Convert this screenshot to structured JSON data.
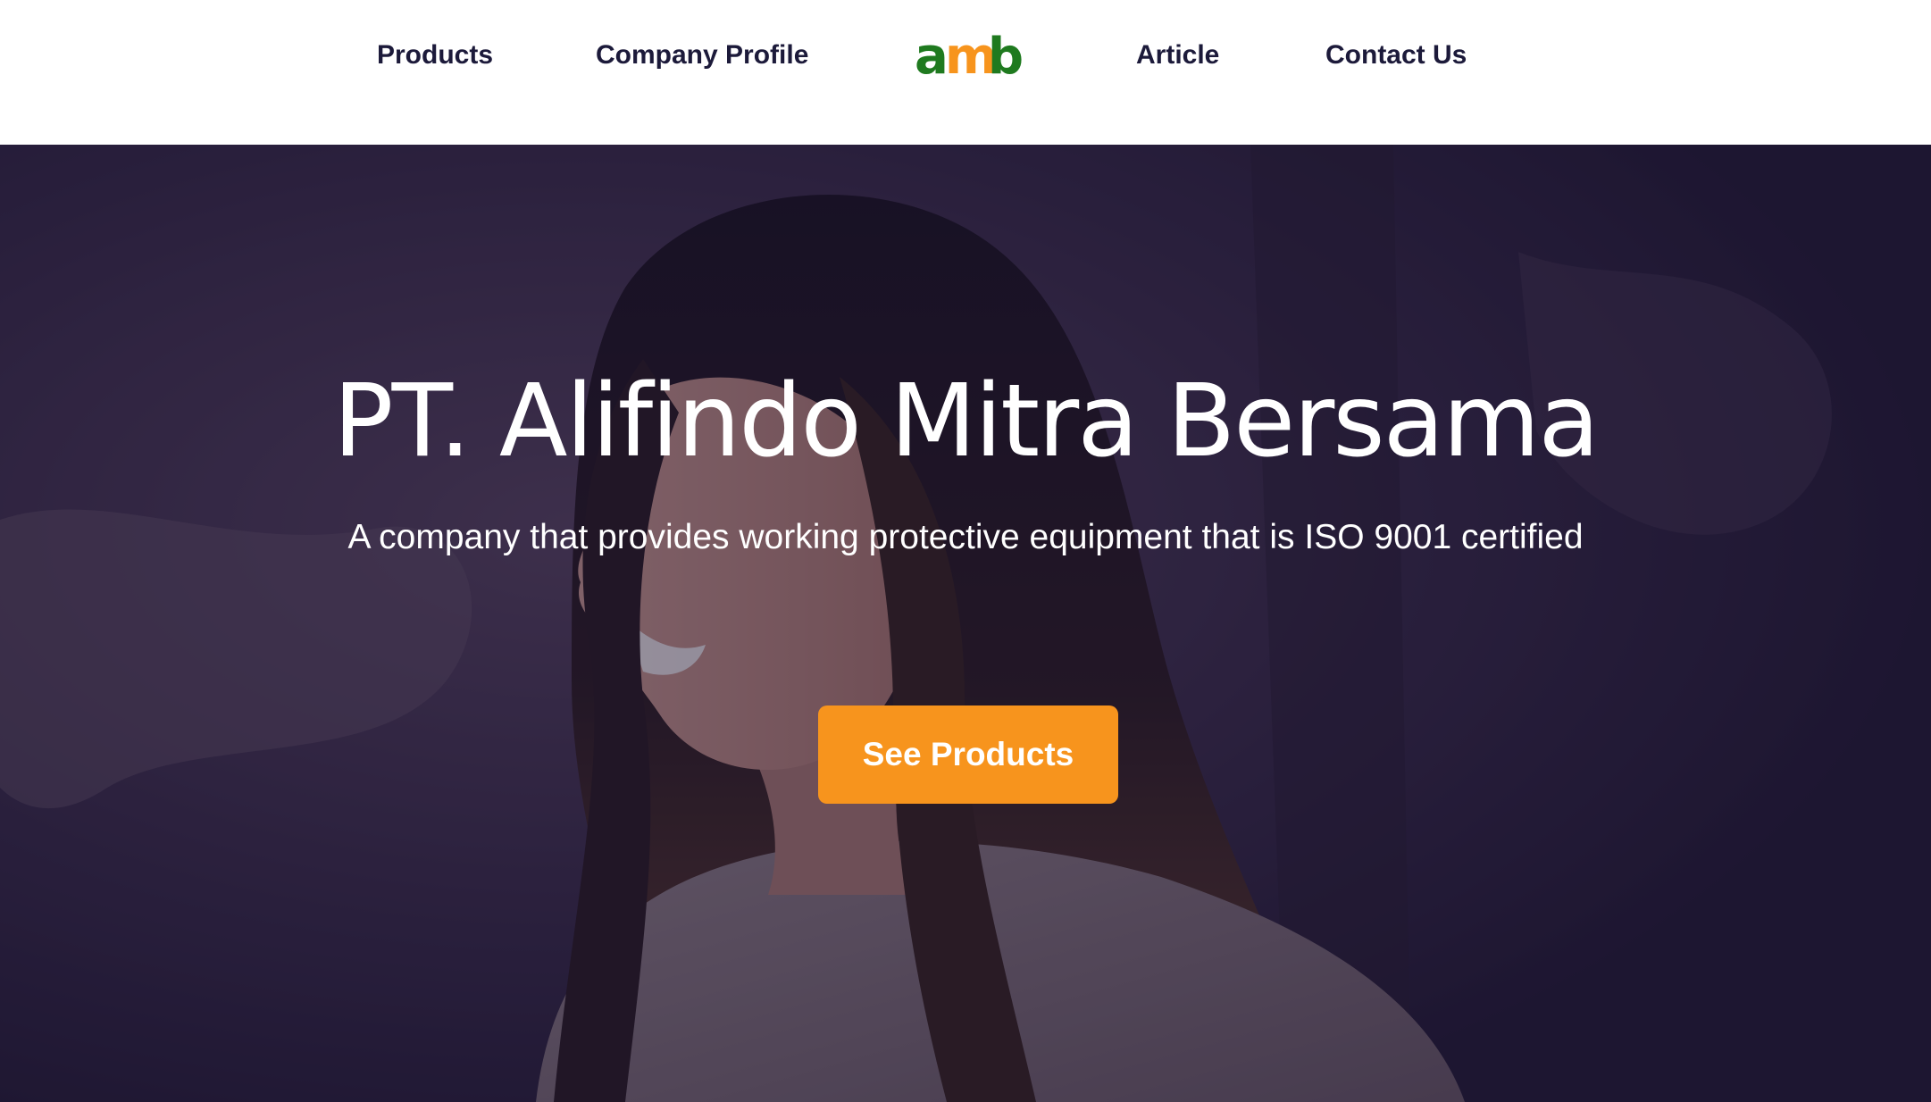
{
  "nav": {
    "items": [
      {
        "label": "Products"
      },
      {
        "label": "Company Profile"
      },
      {
        "label": "Article"
      },
      {
        "label": "Contact Us"
      }
    ],
    "logo": {
      "text": "amb",
      "colors": {
        "a": "#f7941d",
        "m": "#1f7a1f",
        "b": "#1f7a1f"
      }
    }
  },
  "hero": {
    "title": "PT. Alifindo Mitra Bersama",
    "subtitle": "A company that provides working protective equipment that is ISO 9001 certified",
    "button_label": "See Products"
  },
  "colors": {
    "nav_text": "#1c1a3a",
    "accent": "#f7941d",
    "overlay": "#16102c"
  }
}
